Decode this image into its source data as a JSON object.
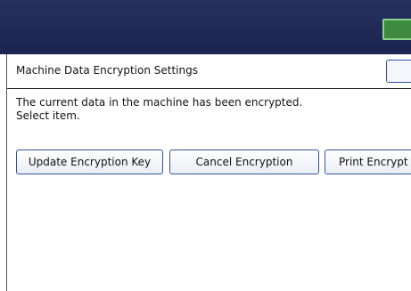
{
  "header": {
    "title": "Machine Data Encryption Settings"
  },
  "message": {
    "line1": "The current data in the machine has been encrypted.",
    "line2": "Select item."
  },
  "actions": {
    "update_label": "Update Encryption Key",
    "cancel_label": "Cancel Encryption",
    "print_label": "Print Encrypt"
  },
  "colors": {
    "titlebar": "#1f2a55",
    "button_border": "#33529f",
    "ok_button": "#3e8a3e"
  }
}
